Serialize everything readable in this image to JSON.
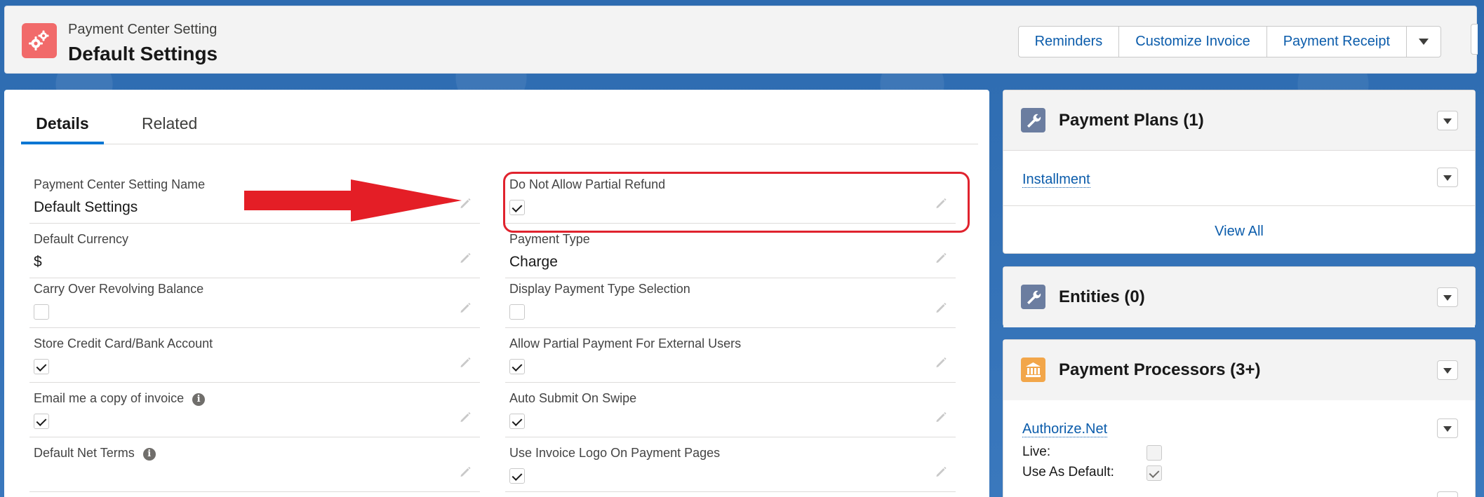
{
  "header": {
    "object_type": "Payment Center Setting",
    "record_title": "Default Settings",
    "buttons": [
      "Reminders",
      "Customize Invoice",
      "Payment Receipt"
    ]
  },
  "tabs": [
    {
      "label": "Details",
      "active": true
    },
    {
      "label": "Related",
      "active": false
    }
  ],
  "fields": {
    "setting_name": {
      "label": "Payment Center Setting Name",
      "value": "Default Settings"
    },
    "partial_refund": {
      "label": "Do Not Allow Partial Refund",
      "checked": true
    },
    "default_currency": {
      "label": "Default Currency",
      "value": "$"
    },
    "payment_type": {
      "label": "Payment Type",
      "value": "Charge"
    },
    "carry_over": {
      "label": "Carry Over Revolving Balance",
      "checked": false
    },
    "display_type_selection": {
      "label": "Display Payment Type Selection",
      "checked": false
    },
    "store_credit_card": {
      "label": "Store Credit Card/Bank Account",
      "checked": true
    },
    "allow_partial_payment": {
      "label": "Allow Partial Payment For External Users",
      "checked": true
    },
    "email_copy": {
      "label": "Email me a copy of invoice",
      "checked": true
    },
    "auto_submit": {
      "label": "Auto Submit On Swipe",
      "checked": true
    },
    "default_net_terms": {
      "label": "Default Net Terms",
      "value": ""
    },
    "invoice_logo": {
      "label": "Use Invoice Logo On Payment Pages",
      "checked": true
    }
  },
  "sidebar": {
    "payment_plans": {
      "title": "Payment Plans (1)",
      "items": [
        "Installment"
      ],
      "view_all": "View All"
    },
    "entities": {
      "title": "Entities (0)"
    },
    "payment_processors": {
      "title": "Payment Processors (3+)",
      "first_item": {
        "name": "Authorize.Net",
        "live_label": "Live:",
        "live": false,
        "default_label": "Use As Default:",
        "default": true
      }
    }
  },
  "colors": {
    "brand_blue": "#0176d3",
    "link": "#0b5cab",
    "object_icon": "#f16a6a",
    "annotation_red": "#e0232e"
  }
}
